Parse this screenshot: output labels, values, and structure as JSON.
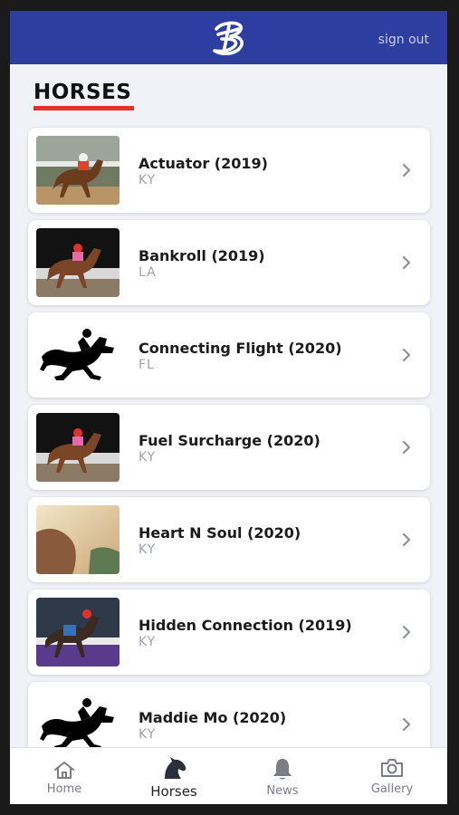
{
  "header": {
    "logo_icon": "b-logo-icon",
    "sign_out_label": "sign out",
    "bg_color": "#2e3ea0"
  },
  "page": {
    "title": "HORSES",
    "accent_color": "#e0322c"
  },
  "horses": [
    {
      "name": "Actuator (2019)",
      "state": "KY",
      "photo": "racing-photo"
    },
    {
      "name": "Bankroll (2019)",
      "state": "LA",
      "photo": "racing-photo"
    },
    {
      "name": "Connecting Flight (2020)",
      "state": "FL",
      "photo": "horse-silhouette-icon"
    },
    {
      "name": "Fuel Surcharge (2020)",
      "state": "KY",
      "photo": "racing-photo"
    },
    {
      "name": "Heart N Soul (2020)",
      "state": "KY",
      "photo": "horse-photo"
    },
    {
      "name": "Hidden Connection (2019)",
      "state": "KY",
      "photo": "racing-photo"
    },
    {
      "name": "Maddie Mo (2020)",
      "state": "KY",
      "photo": "horse-silhouette-icon"
    }
  ],
  "nav": {
    "home": {
      "label": "Home",
      "icon": "home-icon"
    },
    "horses": {
      "label": "Horses",
      "icon": "horse-head-icon",
      "active": true
    },
    "news": {
      "label": "News",
      "icon": "bell-icon"
    },
    "gallery": {
      "label": "Gallery",
      "icon": "camera-icon"
    }
  }
}
